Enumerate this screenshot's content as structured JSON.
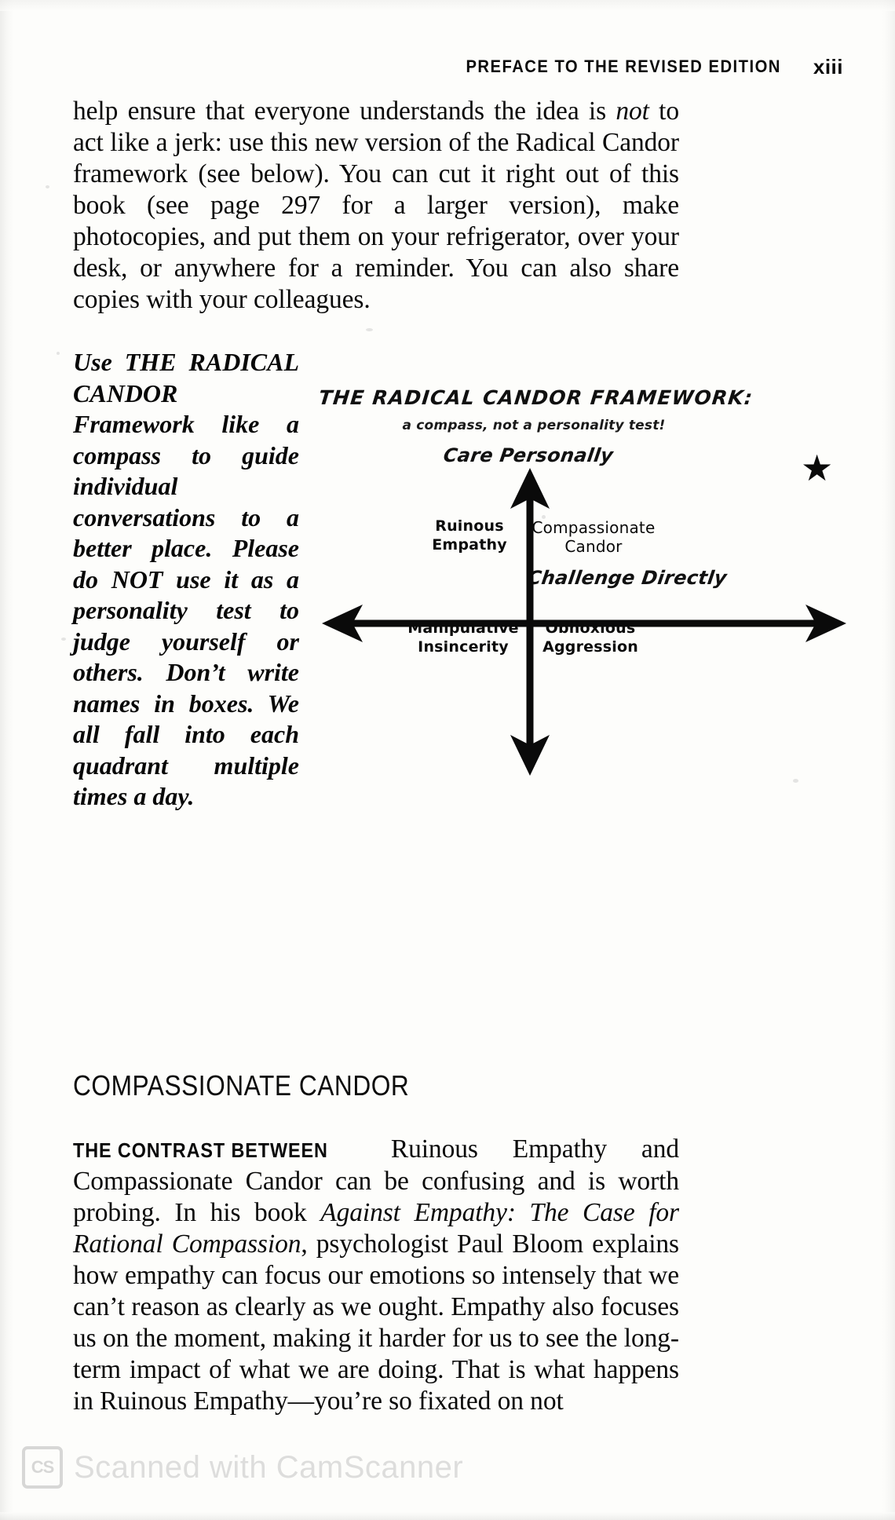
{
  "running_head": {
    "title": "PREFACE TO THE REVISED EDITION",
    "folio": "xiii"
  },
  "intro_paragraph": {
    "before_italic": "help ensure that everyone understands the idea is ",
    "italic": "not",
    "after_italic": " to act like a jerk: use this new version of the Radical Candor framework (see below). You can cut it right out of this book (see page 297 for a larger version), make photocopies, and put them on your refrigerator, over your desk, or anywhere for a reminder. You can also share copies with your colleagues."
  },
  "pullquote": {
    "text": "Use THE RADICAL CANDOR Framework like a compass to guide individual conversations to a better place. Please do NOT use it as a personality test to judge yourself or others. Don’t write names in boxes. We all fall into each quadrant multiple times a day."
  },
  "figure": {
    "title": "THE RADICAL CANDOR FRAMEWORK:",
    "subtitle": "a compass, not a personality test!",
    "vertical_axis_label": "Care Personally",
    "horizontal_axis_label": "Challenge Directly",
    "star_icon": "star-icon",
    "quadrants": [
      {
        "name": "ruinous-empathy",
        "line1": "Ruinous",
        "line2": "Empathy"
      },
      {
        "name": "compassionate-candor",
        "line1": "Compassionate",
        "line2": "Candor"
      },
      {
        "name": "manipulative-insincerity",
        "line1": "Manipulative",
        "line2": "Insincerity"
      },
      {
        "name": "obnoxious-aggression",
        "line1": "Obnoxious",
        "line2": "Aggression"
      }
    ]
  },
  "section": {
    "heading": "COMPASSIONATE CANDOR"
  },
  "closing_paragraph": {
    "lead_in": "THE CONTRAST BETWEEN",
    "part1": " Ruinous Empathy and Compassionate Candor can be confusing and is worth probing. In his book ",
    "italic_title": "Against Empathy: The Case for Rational Compassion",
    "part2": ", psychologist Paul Bloom explains how empathy can focus our emotions so intensely that we can’t reason as clearly as we ought. Empathy also focuses us on the moment, making it harder for us to see the long-term impact of what we are doing. That is what happens in Ruinous Empathy—you’re so fixated on not"
  },
  "watermark": {
    "badge": "CS",
    "text": "Scanned with CamScanner"
  },
  "colors": {
    "ink": "#0a0a0a",
    "paper": "#fdfdfb",
    "watermark": "#c3c3c3"
  }
}
